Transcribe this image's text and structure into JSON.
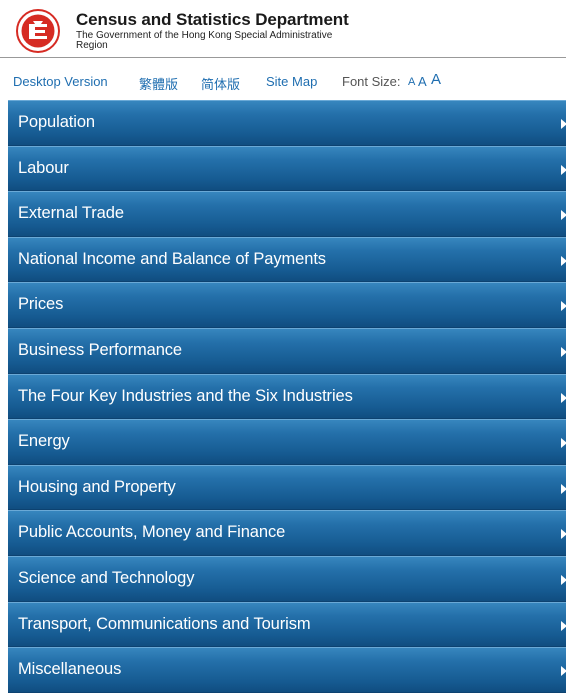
{
  "header": {
    "logo_icon": "hksar-emblem-icon",
    "title": "Census and Statistics Department",
    "subtitle": "The Government of the Hong Kong Special Administrative Region"
  },
  "toplinks": {
    "desktop": "Desktop Version",
    "traditional": "繁體版",
    "simplified": "简体版",
    "sitemap": "Site Map",
    "font_size_label": "Font Size:",
    "font_small": "A",
    "font_medium": "A",
    "font_large": "A"
  },
  "menu": {
    "items": [
      {
        "label": "Population"
      },
      {
        "label": "Labour"
      },
      {
        "label": "External Trade"
      },
      {
        "label": "National Income and Balance of Payments"
      },
      {
        "label": "Prices"
      },
      {
        "label": "Business Performance"
      },
      {
        "label": "The Four Key Industries and the Six Industries"
      },
      {
        "label": "Energy"
      },
      {
        "label": "Housing and Property"
      },
      {
        "label": "Public Accounts, Money and Finance"
      },
      {
        "label": "Science and Technology"
      },
      {
        "label": "Transport, Communications and Tourism"
      },
      {
        "label": "Miscellaneous"
      }
    ],
    "arrow_icon": "chevron-right-icon"
  },
  "colors": {
    "link": "#1f6eb0",
    "menu_background": "#1c64a0",
    "logo_red": "#d62b23"
  }
}
